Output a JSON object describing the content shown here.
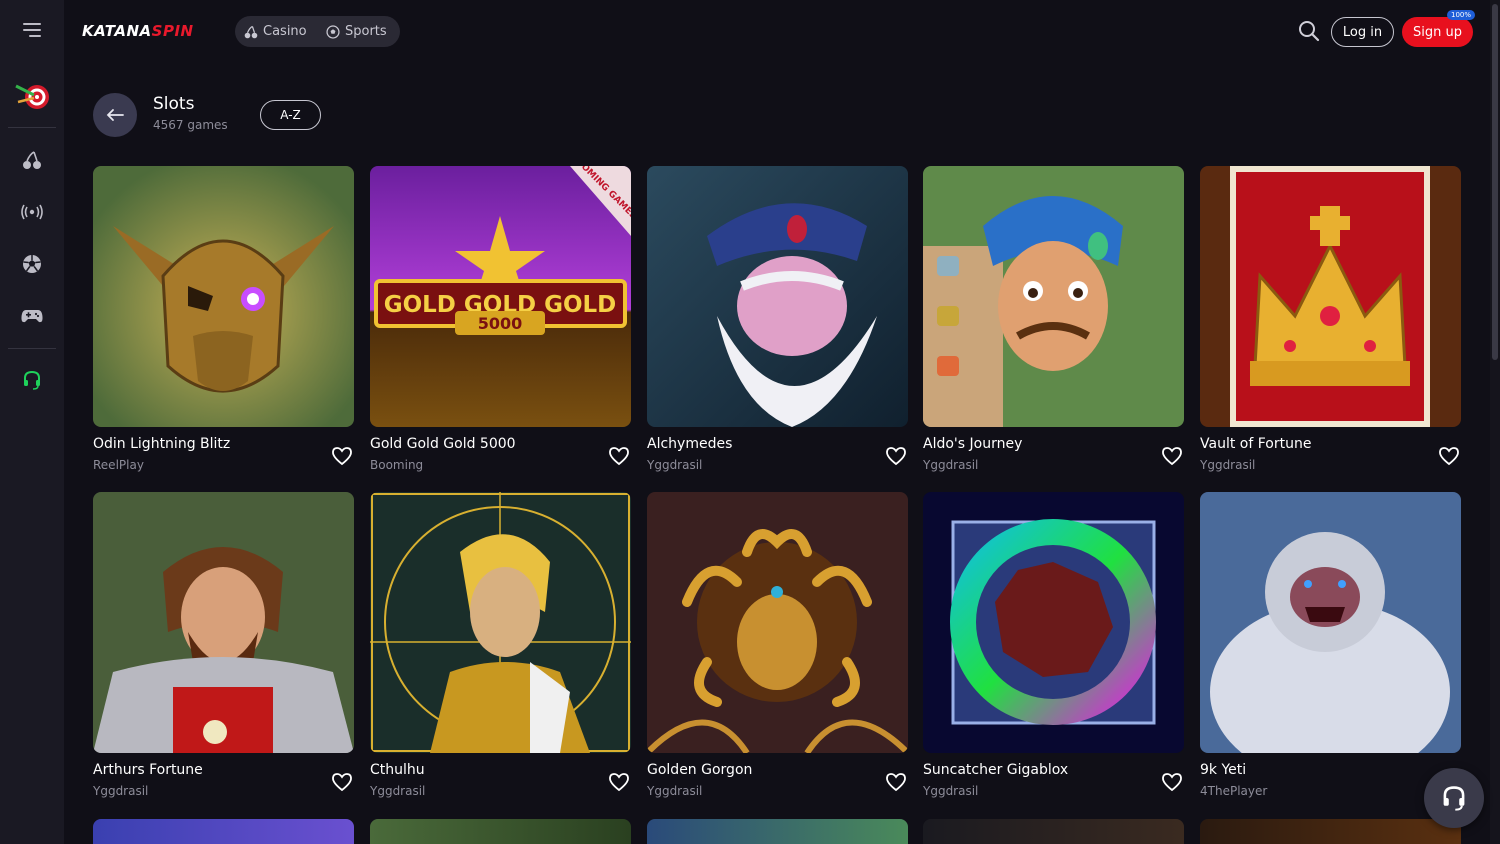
{
  "brand": {
    "logo_white": "KATANA",
    "logo_red": "SPIN"
  },
  "nav_pill": {
    "casino": "Casino",
    "sports": "Sports"
  },
  "header": {
    "login": "Log in",
    "signup": "Sign up",
    "signup_badge": "100%"
  },
  "section": {
    "title": "Slots",
    "count": "4567 games",
    "sort": "A-Z"
  },
  "games": [
    {
      "name": "Odin Lightning Blitz",
      "provider": "ReelPlay"
    },
    {
      "name": "Gold Gold Gold 5000",
      "provider": "Booming",
      "art_text": "GOLD GOLD GOLD",
      "art_num": "5000",
      "art_ribbon": "BOOMING GAMES"
    },
    {
      "name": "Alchymedes",
      "provider": "Yggdrasil"
    },
    {
      "name": "Aldo's Journey",
      "provider": "Yggdrasil"
    },
    {
      "name": "Vault of Fortune",
      "provider": "Yggdrasil"
    },
    {
      "name": "Arthurs Fortune",
      "provider": "Yggdrasil"
    },
    {
      "name": "Cthulhu",
      "provider": "Yggdrasil"
    },
    {
      "name": "Golden Gorgon",
      "provider": "Yggdrasil"
    },
    {
      "name": "Suncatcher Gigablox",
      "provider": "Yggdrasil"
    },
    {
      "name": "9k Yeti",
      "provider": "4ThePlayer"
    }
  ],
  "colors": {
    "bg": "#100f17",
    "sidebar": "#1a1923",
    "accent_red": "#e8101e",
    "support_green": "#1fd15b"
  }
}
